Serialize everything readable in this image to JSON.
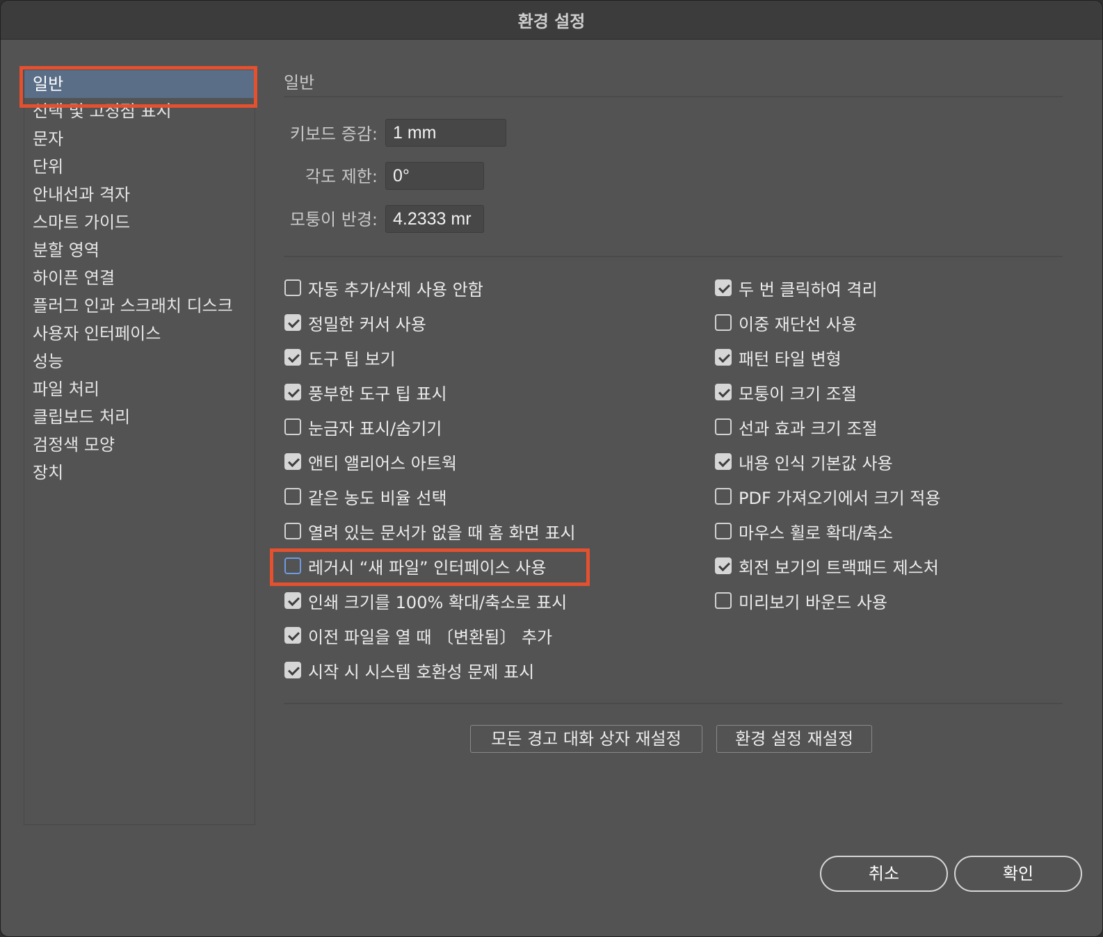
{
  "window": {
    "title": "환경 설정"
  },
  "sidebar": {
    "items": [
      {
        "label": "일반",
        "selected": true
      },
      {
        "label": "선택 및 고정점 표시"
      },
      {
        "label": "문자"
      },
      {
        "label": "단위"
      },
      {
        "label": "안내선과 격자"
      },
      {
        "label": "스마트 가이드"
      },
      {
        "label": "분할 영역"
      },
      {
        "label": "하이픈 연결"
      },
      {
        "label": "플러그 인과 스크래치 디스크"
      },
      {
        "label": "사용자 인터페이스"
      },
      {
        "label": "성능"
      },
      {
        "label": "파일 처리"
      },
      {
        "label": "클립보드 처리"
      },
      {
        "label": "검정색 모양"
      },
      {
        "label": "장치"
      }
    ]
  },
  "main": {
    "section_title": "일반",
    "fields": {
      "keyboard_increment": {
        "label": "키보드 증감:",
        "value": "1 mm"
      },
      "constrain_angle": {
        "label": "각도 제한:",
        "value": "0°"
      },
      "corner_radius": {
        "label": "모퉁이 반경:",
        "value": "4.2333 mr"
      }
    },
    "left_checkboxes": [
      {
        "label": "자동 추가/삭제 사용 안함",
        "checked": false
      },
      {
        "label": "정밀한 커서 사용",
        "checked": true
      },
      {
        "label": "도구 팁 보기",
        "checked": true
      },
      {
        "label": "풍부한 도구 팁 표시",
        "checked": true
      },
      {
        "label": "눈금자 표시/숨기기",
        "checked": false
      },
      {
        "label": "앤티 앨리어스 아트웍",
        "checked": true
      },
      {
        "label": "같은 농도 비율 선택",
        "checked": false
      },
      {
        "label": "열려 있는 문서가 없을 때 홈 화면 표시",
        "checked": false
      },
      {
        "label": "레거시 “새 파일” 인터페이스 사용",
        "checked": false,
        "focused": true
      },
      {
        "label": "인쇄 크기를 100% 확대/축소로 표시",
        "checked": true
      },
      {
        "label": "이전 파일을 열 때 〔변환됨〕 추가",
        "checked": true
      },
      {
        "label": "시작 시 시스템 호환성 문제 표시",
        "checked": true
      }
    ],
    "right_checkboxes": [
      {
        "label": "두 번 클릭하여 격리",
        "checked": true
      },
      {
        "label": "이중 재단선 사용",
        "checked": false
      },
      {
        "label": "패턴 타일 변형",
        "checked": true
      },
      {
        "label": "모퉁이 크기 조절",
        "checked": true
      },
      {
        "label": "선과 효과 크기 조절",
        "checked": false
      },
      {
        "label": "내용 인식 기본값 사용",
        "checked": true
      },
      {
        "label": "PDF 가져오기에서 크기 적용",
        "checked": false
      },
      {
        "label": "마우스 휠로 확대/축소",
        "checked": false
      },
      {
        "label": "회전 보기의 트랙패드 제스처",
        "checked": true
      },
      {
        "label": "미리보기 바운드 사용",
        "checked": false
      }
    ],
    "buttons": {
      "reset_warnings": "모든 경고 대화 상자 재설정",
      "reset_prefs": "환경 설정 재설정"
    }
  },
  "footer": {
    "cancel": "취소",
    "ok": "확인"
  },
  "colors": {
    "highlight": "#e5502f",
    "selection": "#5a6e87",
    "background": "#535353"
  }
}
